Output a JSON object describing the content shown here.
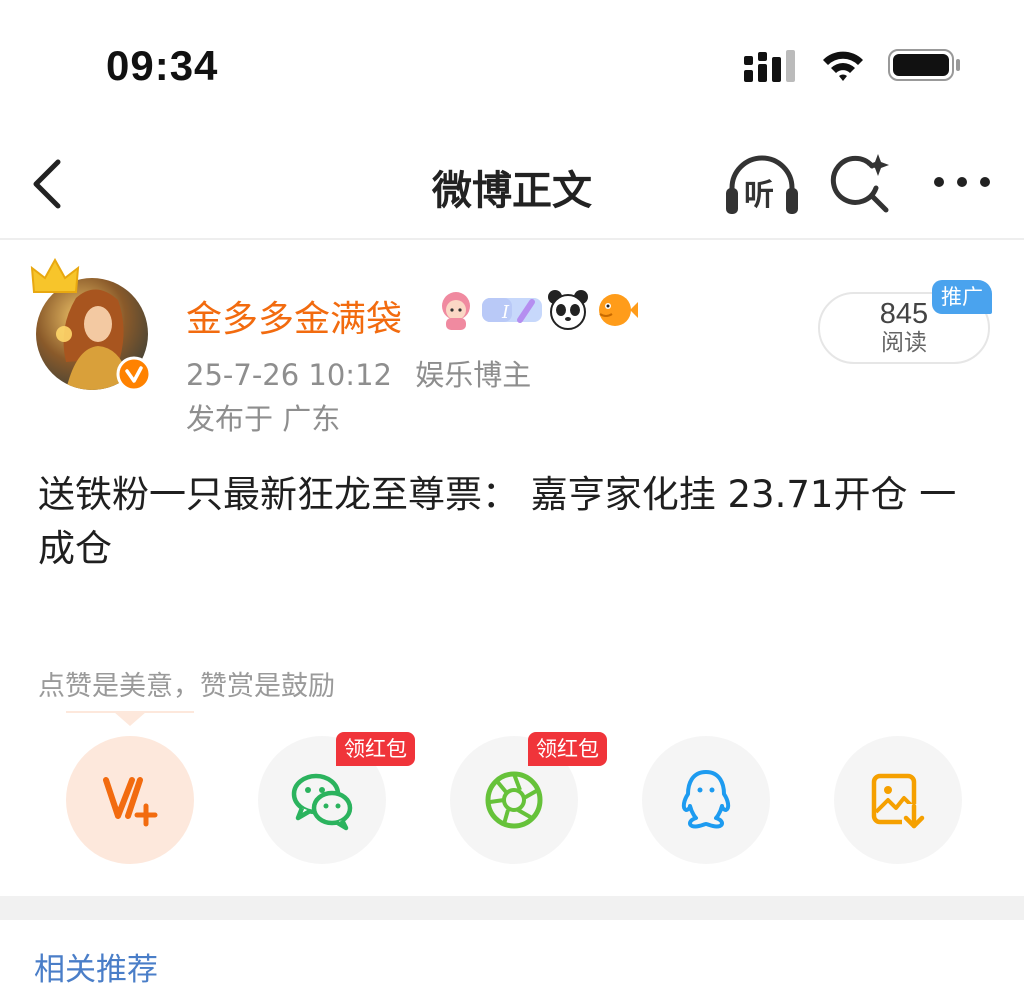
{
  "status_bar": {
    "time": "09:34",
    "icons": [
      "signal-icon",
      "wifi-icon",
      "battery-icon"
    ]
  },
  "nav": {
    "title": "微博正文",
    "listen_label": "听",
    "icons": [
      "back-icon",
      "listen-headphones-icon",
      "ai-search-icon",
      "more-icon"
    ]
  },
  "author": {
    "name": "金多多金满袋",
    "badges": [
      "princess-badge-icon",
      "level-badge-icon",
      "panda-badge-icon",
      "pufferfish-badge-icon"
    ],
    "timestamp": "25-7-26 10:12",
    "category": "娱乐博主",
    "location": "发布于 广东"
  },
  "read_badge": {
    "count": "845",
    "label": "阅读",
    "promo_tag": "推广"
  },
  "post": {
    "text": "送铁粉一只最新狂龙至尊票： 嘉亨家化挂 23.71开仓 一成仓"
  },
  "reward_hint": "点赞是美意，赞赏是鼓励",
  "share": {
    "redpack_label_wechat": "领红包",
    "redpack_label_moments": "领红包",
    "items": [
      "v-plus-icon",
      "wechat-icon",
      "moments-icon",
      "qq-icon",
      "save-image-icon"
    ]
  },
  "related": {
    "title": "相关推荐"
  },
  "colors": {
    "accent_orange": "#f26b0f",
    "promo_blue": "#4aa3ee",
    "redpack_red": "#f0343a",
    "wechat_green": "#2bb35e",
    "qq_blue": "#1d9bf0",
    "link_blue": "#4a7ec8"
  }
}
